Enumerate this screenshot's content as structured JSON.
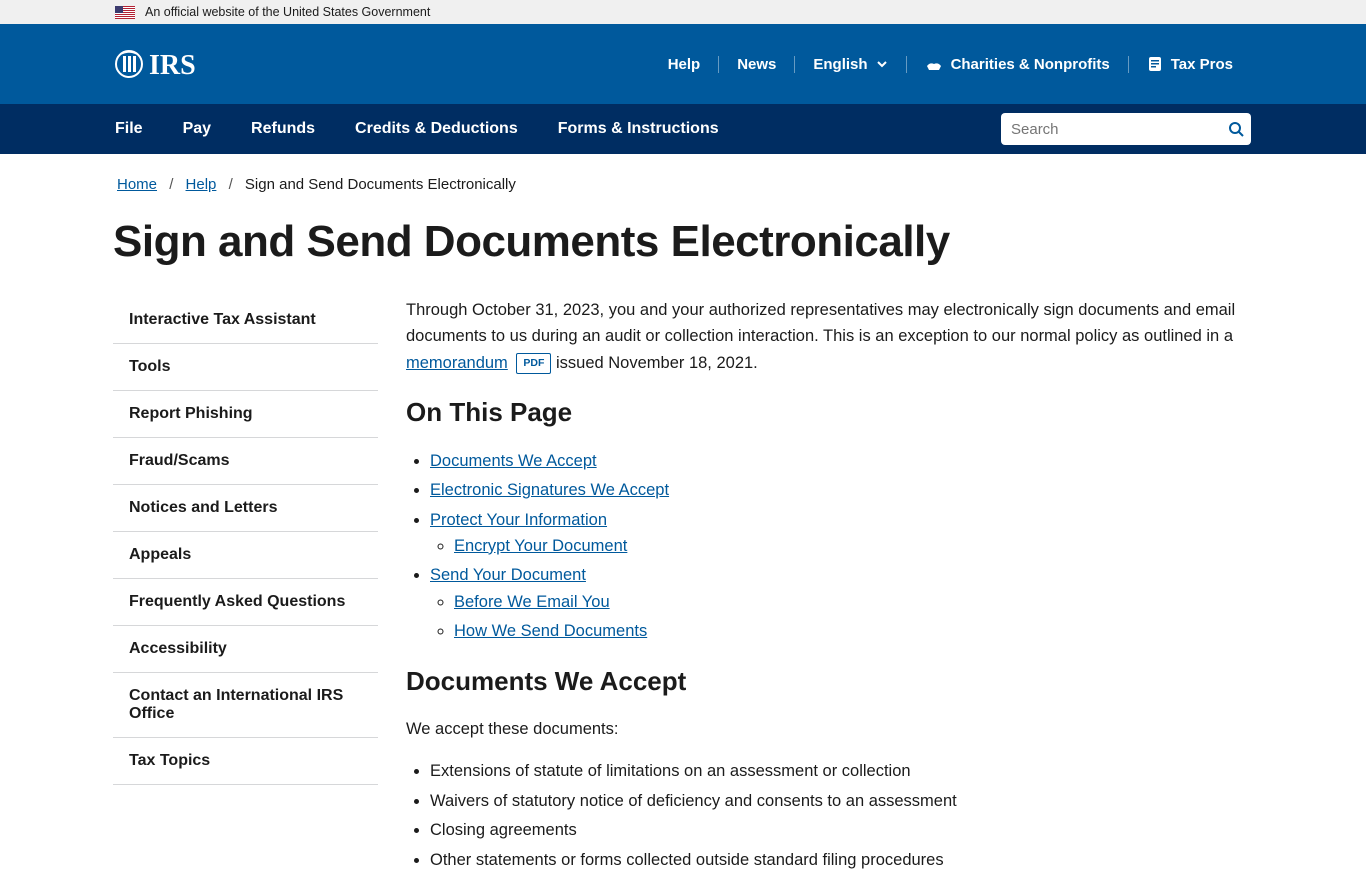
{
  "govBanner": "An official website of the United States Government",
  "header": {
    "links": {
      "help": "Help",
      "news": "News",
      "language": "English",
      "charities": "Charities & Nonprofits",
      "taxpros": "Tax Pros"
    }
  },
  "nav": {
    "items": [
      "File",
      "Pay",
      "Refunds",
      "Credits & Deductions",
      "Forms & Instructions"
    ],
    "searchPlaceholder": "Search"
  },
  "breadcrumb": {
    "home": "Home",
    "help": "Help",
    "current": "Sign and Send Documents Electronically"
  },
  "pageTitle": "Sign and Send Documents Electronically",
  "sidebar": {
    "items": [
      "Interactive Tax Assistant",
      "Tools",
      "Report Phishing",
      "Fraud/Scams",
      "Notices and Letters",
      "Appeals",
      "Frequently Asked Questions",
      "Accessibility",
      "Contact an International IRS Office",
      "Tax Topics"
    ]
  },
  "content": {
    "introBefore": "Through October 31, 2023, you and your authorized representatives may electronically sign documents and email documents to us during an audit or collection interaction. This is an exception to our normal policy as outlined in a ",
    "memoLink": "memorandum",
    "pdfBadge": "PDF",
    "introAfter": " issued November 18, 2021.",
    "onThisPage": "On This Page",
    "toc": {
      "docsAccept": "Documents We Accept",
      "sigAccept": "Electronic Signatures We Accept",
      "protect": "Protect Your Information",
      "encrypt": "Encrypt Your Document",
      "send": "Send Your Document",
      "before": "Before We Email You",
      "howSend": "How We Send Documents"
    },
    "docsHeading": "Documents We Accept",
    "docsIntro": "We accept these documents:",
    "docsList": [
      "Extensions of statute of limitations on an assessment or collection",
      "Waivers of statutory notice of deficiency and consents to an assessment",
      "Closing agreements",
      "Other statements or forms collected outside standard filing procedures"
    ]
  }
}
